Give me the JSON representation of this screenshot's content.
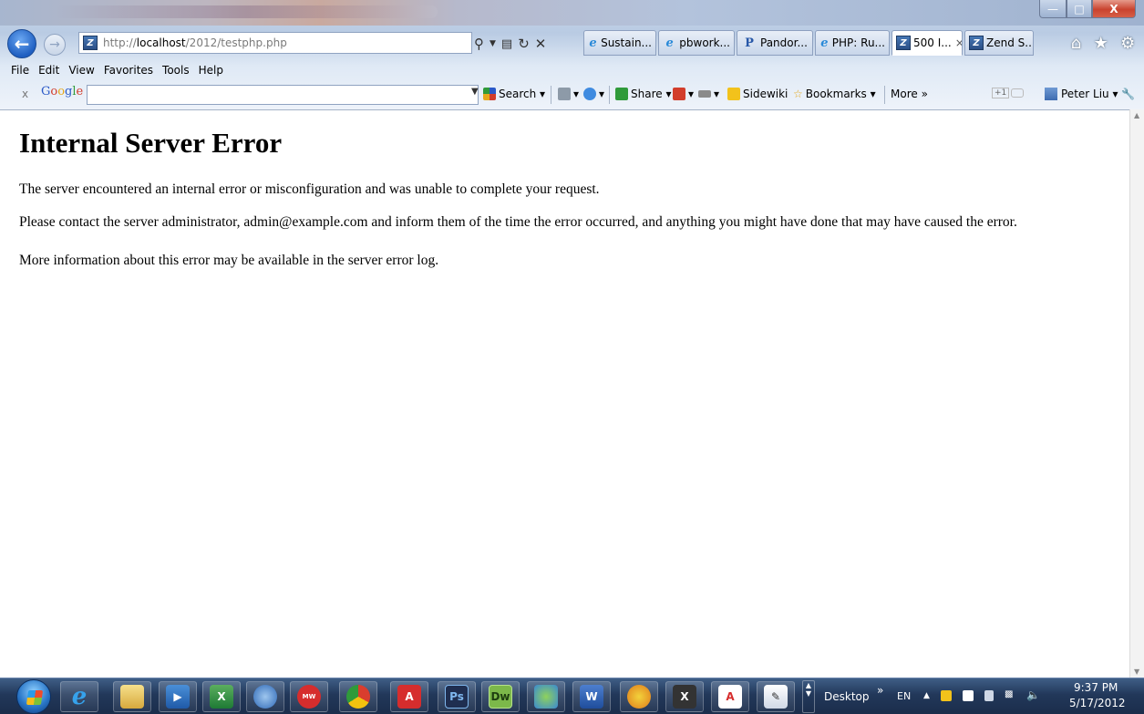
{
  "window": {
    "minimize_icon": "minimize-icon",
    "maximize_icon": "maximize-icon",
    "close_label": "X"
  },
  "nav": {
    "address_prefix": "http://",
    "address_host": "localhost",
    "address_path": "/2012/testphp.php",
    "tabs": [
      {
        "label": "Sustain...",
        "icon": "ie-icon"
      },
      {
        "label": "pbwork...",
        "icon": "ie-icon"
      },
      {
        "label": "Pandor...",
        "icon": "pandora-icon"
      },
      {
        "label": "PHP: Ru...",
        "icon": "ie-icon"
      },
      {
        "label": "500 I...",
        "icon": "zend-icon",
        "active": true
      },
      {
        "label": "Zend S...",
        "icon": "zend-icon"
      }
    ]
  },
  "menu": [
    "File",
    "Edit",
    "View",
    "Favorites",
    "Tools",
    "Help"
  ],
  "google_toolbar": {
    "close": "x",
    "logo": "Google",
    "search_value": "",
    "search_label": "Search",
    "share_label": "Share",
    "sidewiki_label": "Sidewiki",
    "bookmarks_label": "Bookmarks",
    "more_label": "More",
    "plus_one": "+1",
    "user_label": "Peter Liu"
  },
  "page": {
    "title": "Internal Server Error",
    "paragraph1": "The server encountered an internal error or misconfiguration and was unable to complete your request.",
    "paragraph2": "Please contact the server administrator, admin@example.com and inform them of the time the error occurred, and anything you might have done that may have caused the error.",
    "paragraph3": "More information about this error may be available in the server error log."
  },
  "taskbar": {
    "apps": [
      "internet-explorer",
      "windows-explorer",
      "media-player",
      "excel",
      "thunderbird",
      "merriam-webster",
      "chrome",
      "acrobat",
      "photoshop",
      "dreamweaver",
      "messenger",
      "word",
      "winamp",
      "xmind",
      "acrobat-2",
      "notepad"
    ],
    "labels": {
      "photoshop": "Ps",
      "dreamweaver": "Dw"
    },
    "desktop_label": "Desktop",
    "language": "EN",
    "time": "9:37 PM",
    "date": "5/17/2012"
  }
}
